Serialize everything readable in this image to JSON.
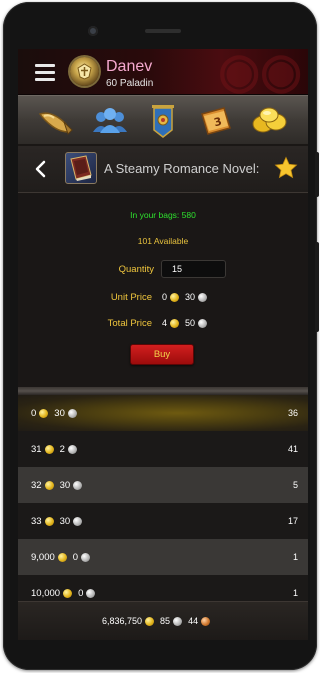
{
  "header": {
    "character_name": "Danev",
    "character_subtitle": "60 Paladin"
  },
  "nav": {
    "items": [
      {
        "icon": "horn-icon"
      },
      {
        "icon": "guild-icon"
      },
      {
        "icon": "banner-icon"
      },
      {
        "icon": "calendar-icon"
      },
      {
        "icon": "gold-coins-icon"
      }
    ]
  },
  "item": {
    "title": "A Steamy Romance Novel:",
    "icon": "book-icon"
  },
  "info": {
    "bags_text": "In your bags: 580",
    "available_text": "101 Available",
    "quantity_label": "Quantity",
    "quantity_value": "15",
    "unit_price_label": "Unit Price",
    "unit_price": {
      "gold": "0",
      "silver": "30"
    },
    "total_price_label": "Total Price",
    "total_price": {
      "gold": "4",
      "silver": "50"
    },
    "buy_label": "Buy"
  },
  "listings": [
    {
      "gold": "0",
      "silver": "30",
      "quantity": "36",
      "style": "sel"
    },
    {
      "gold": "31",
      "silver": "2",
      "quantity": "41",
      "style": "norm"
    },
    {
      "gold": "32",
      "silver": "30",
      "quantity": "5",
      "style": "alt"
    },
    {
      "gold": "33",
      "silver": "30",
      "quantity": "17",
      "style": "norm"
    },
    {
      "gold": "9,000",
      "silver": "0",
      "quantity": "1",
      "style": "alt"
    },
    {
      "gold": "10,000",
      "silver": "0",
      "quantity": "1",
      "style": "norm"
    }
  ],
  "footer": {
    "gold": "6,836,750",
    "silver": "85",
    "copper": "44"
  },
  "colors": {
    "character_name": "#f5a9cf",
    "bags_text": "#2ee12e",
    "label_gold": "#f0c63d",
    "buy_button": "#d21f1f"
  }
}
